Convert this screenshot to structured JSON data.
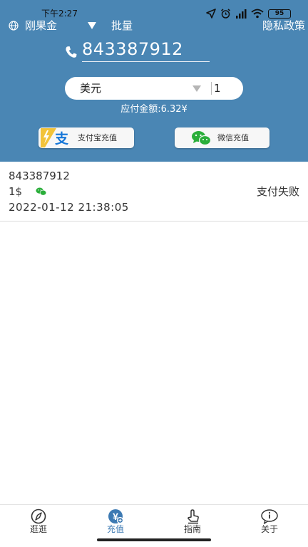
{
  "status_bar": {
    "time": "下午2:27",
    "battery": "95"
  },
  "top_bar": {
    "region": "刚果金",
    "batch_label": "批量",
    "privacy_label": "隐私政策"
  },
  "phone": {
    "number": "843387912"
  },
  "amount": {
    "currency": "美元",
    "value": "1"
  },
  "payable_text": "应付金额:6.32¥",
  "buttons": {
    "alipay": "支付宝充值",
    "wechat": "微信充值"
  },
  "record": {
    "phone": "843387912",
    "amount": "1$",
    "status": "支付失败",
    "time": "2022-01-12 21:38:05"
  },
  "tabs": [
    {
      "label": "逛逛",
      "icon": "compass-icon"
    },
    {
      "label": "充值",
      "icon": "recharge-icon",
      "active": true
    },
    {
      "label": "指南",
      "icon": "guide-icon"
    },
    {
      "label": "关于",
      "icon": "info-icon"
    }
  ],
  "colors": {
    "header": "#4a86b4",
    "accent": "#3d7ab3",
    "wechat": "#2aae3a"
  }
}
